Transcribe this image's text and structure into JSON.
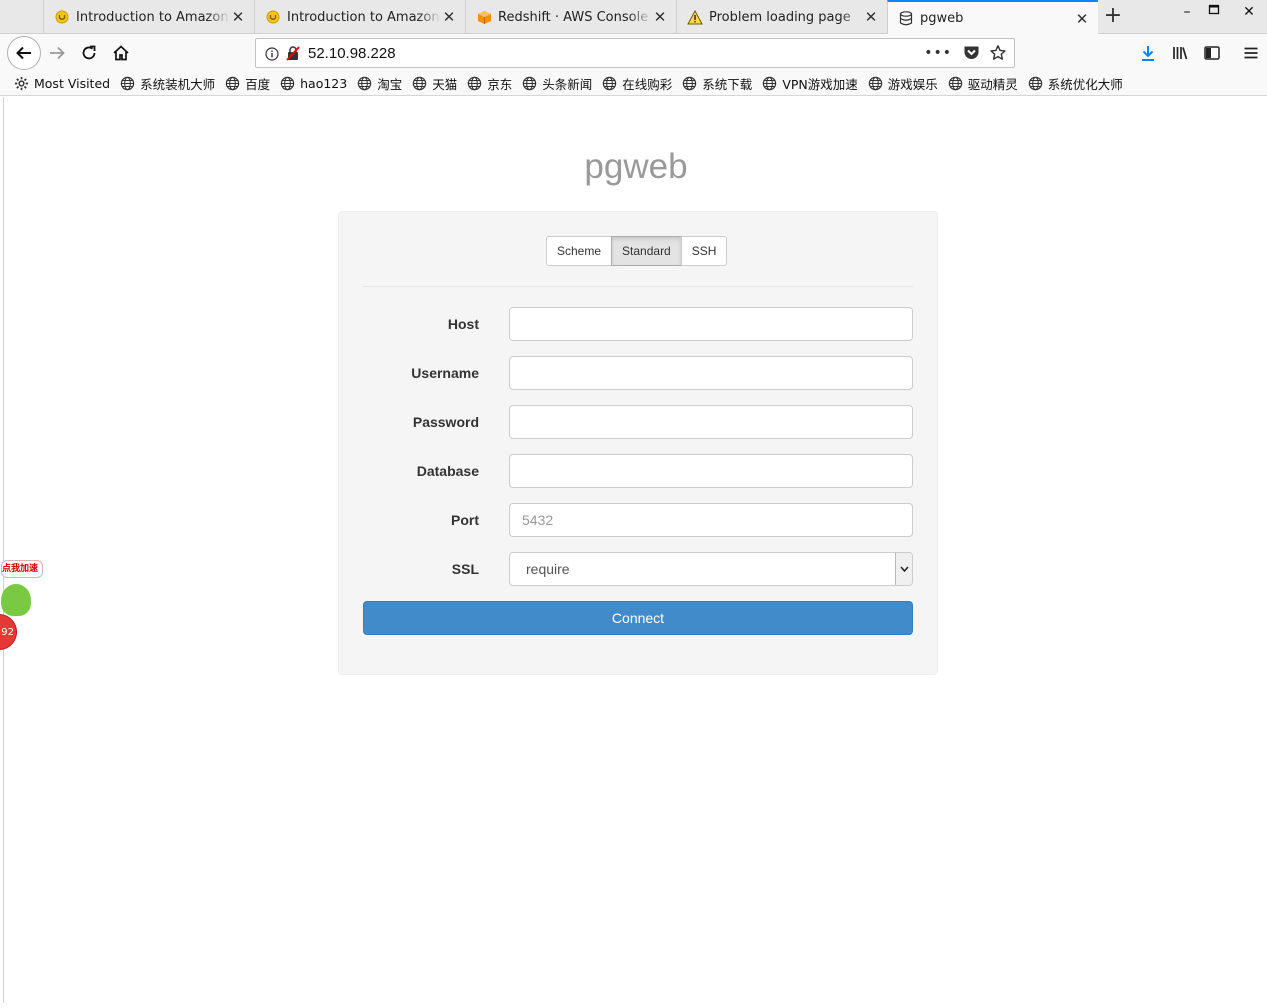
{
  "browser": {
    "tabs": [
      {
        "title": "Introduction to Amazon R",
        "favicon": "yellow-circle-icon",
        "active": false
      },
      {
        "title": "Introduction to Amazon R",
        "favicon": "yellow-circle-icon",
        "active": false
      },
      {
        "title": "Redshift · AWS Console",
        "favicon": "aws-box-icon",
        "active": false
      },
      {
        "title": "Problem loading page",
        "favicon": "warning-icon",
        "active": false
      },
      {
        "title": "pgweb",
        "favicon": "database-icon",
        "active": true
      }
    ],
    "address": "52.10.98.228",
    "bookmarks": [
      {
        "label": "Most Visited",
        "icon": "gear-icon"
      },
      {
        "label": "系统装机大师",
        "icon": "globe-icon"
      },
      {
        "label": "百度",
        "icon": "globe-icon"
      },
      {
        "label": "hao123",
        "icon": "globe-icon"
      },
      {
        "label": "淘宝",
        "icon": "globe-icon"
      },
      {
        "label": "天猫",
        "icon": "globe-icon"
      },
      {
        "label": "京东",
        "icon": "globe-icon"
      },
      {
        "label": "头条新闻",
        "icon": "globe-icon"
      },
      {
        "label": "在线购彩",
        "icon": "globe-icon"
      },
      {
        "label": "系统下载",
        "icon": "globe-icon"
      },
      {
        "label": "VPN游戏加速",
        "icon": "globe-icon"
      },
      {
        "label": "游戏娱乐",
        "icon": "globe-icon"
      },
      {
        "label": "驱动精灵",
        "icon": "globe-icon"
      },
      {
        "label": "系统优化大师",
        "icon": "globe-icon"
      }
    ]
  },
  "page": {
    "title": "pgweb",
    "tabs": [
      {
        "label": "Scheme",
        "active": false
      },
      {
        "label": "Standard",
        "active": true
      },
      {
        "label": "SSH",
        "active": false
      }
    ],
    "fields": {
      "host": {
        "label": "Host",
        "value": ""
      },
      "username": {
        "label": "Username",
        "value": ""
      },
      "password": {
        "label": "Password",
        "value": ""
      },
      "database": {
        "label": "Database",
        "value": ""
      },
      "port": {
        "label": "Port",
        "placeholder": "5432",
        "value": ""
      },
      "ssl": {
        "label": "SSL",
        "value": "require"
      }
    },
    "connect_label": "Connect"
  },
  "widget": {
    "bubble_text": "点我加速",
    "badge_text": "92"
  },
  "colors": {
    "primary_button": "#428bca",
    "tab_accent": "#0a84ff",
    "title_gray": "#999999"
  }
}
